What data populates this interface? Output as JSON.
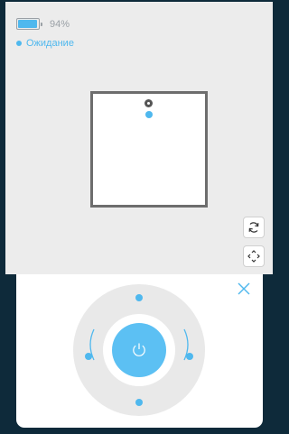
{
  "status_bar": {
    "battery_level": 0.94,
    "battery_text": "94%"
  },
  "state": {
    "label": "Ожидание",
    "dot_color": "#4fb8ee"
  },
  "map": {
    "dock_icon": "dock-station-icon",
    "robot_icon": "robot-position-icon",
    "buttons": [
      {
        "name": "rotate-map-button",
        "icon": "rotate-icon"
      },
      {
        "name": "fit-map-button",
        "icon": "expand-arrows-icon"
      }
    ]
  },
  "control_panel": {
    "close_icon": "close-icon",
    "power_icon": "power-icon",
    "accent_color": "#5cc0f3",
    "directions": [
      "forward",
      "left",
      "right",
      "backward"
    ]
  }
}
